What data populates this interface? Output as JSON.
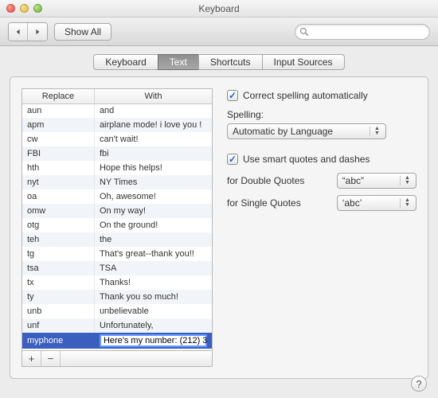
{
  "window": {
    "title": "Keyboard"
  },
  "toolbar": {
    "show_all": "Show All",
    "search_placeholder": ""
  },
  "tabs": {
    "keyboard": "Keyboard",
    "text": "Text",
    "shortcuts": "Shortcuts",
    "input_sources": "Input Sources",
    "active": "text"
  },
  "table": {
    "headers": {
      "replace": "Replace",
      "with": "With"
    },
    "rows": [
      {
        "replace": "aun",
        "with": "and"
      },
      {
        "replace": "apm",
        "with": "airplane mode! i love you !"
      },
      {
        "replace": "cw",
        "with": "can't wait!"
      },
      {
        "replace": "FBI",
        "with": "fbi"
      },
      {
        "replace": "hth",
        "with": "Hope this helps!"
      },
      {
        "replace": "nyt",
        "with": "NY Times"
      },
      {
        "replace": "oa",
        "with": "Oh, awesome!"
      },
      {
        "replace": "omw",
        "with": "On my way!"
      },
      {
        "replace": "otg",
        "with": "On the ground!"
      },
      {
        "replace": "teh",
        "with": "the"
      },
      {
        "replace": "tg",
        "with": "That's great--thank you!!"
      },
      {
        "replace": "tsa",
        "with": "TSA"
      },
      {
        "replace": "tx",
        "with": "Thanks!"
      },
      {
        "replace": "ty",
        "with": "Thank you so much!"
      },
      {
        "replace": "unb",
        "with": "unbelievable"
      },
      {
        "replace": "unf",
        "with": "Unfortunately,"
      },
      {
        "replace": "myphone",
        "with": "Here's my number: (212) 3",
        "selected": true,
        "editing": true
      }
    ],
    "footer": {
      "add": "+",
      "remove": "−"
    }
  },
  "settings": {
    "correct_spelling_label": "Correct spelling automatically",
    "correct_spelling_checked": true,
    "spelling_heading": "Spelling:",
    "spelling_value": "Automatic by Language",
    "smart_quotes_label": "Use smart quotes and dashes",
    "smart_quotes_checked": true,
    "double_label": "for Double Quotes",
    "double_value": "“abc”",
    "single_label": "for Single Quotes",
    "single_value": "‘abc’"
  },
  "help_label": "?"
}
